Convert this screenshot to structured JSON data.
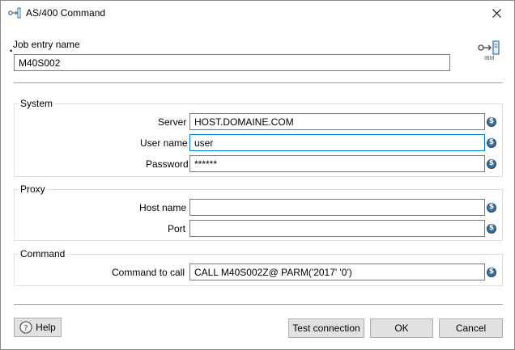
{
  "window": {
    "title": "AS/400 Command",
    "close_icon": "close-icon",
    "app_icon": "as400-job-icon"
  },
  "job_entry": {
    "label": "Job entry name",
    "value": "M40S002"
  },
  "logo": {
    "icon": "ibm-server-icon",
    "text": "IBM"
  },
  "system": {
    "title": "System",
    "server": {
      "label": "Server",
      "value": "HOST.DOMAINE.COM"
    },
    "username": {
      "label": "User name",
      "value": "user"
    },
    "password": {
      "label": "Password",
      "value": "******"
    }
  },
  "proxy": {
    "title": "Proxy",
    "hostname": {
      "label": "Host name",
      "value": ""
    },
    "port": {
      "label": "Port",
      "value": ""
    }
  },
  "command": {
    "title": "Command",
    "call": {
      "label": "Command to call",
      "value": "CALL M40S002Z@ PARM('2017' '0')"
    }
  },
  "buttons": {
    "help": "Help",
    "test_connection": "Test connection",
    "ok": "OK",
    "cancel": "Cancel"
  },
  "colors": {
    "focus_border": "#0078d7",
    "variable_icon": "#3a6d9a"
  }
}
